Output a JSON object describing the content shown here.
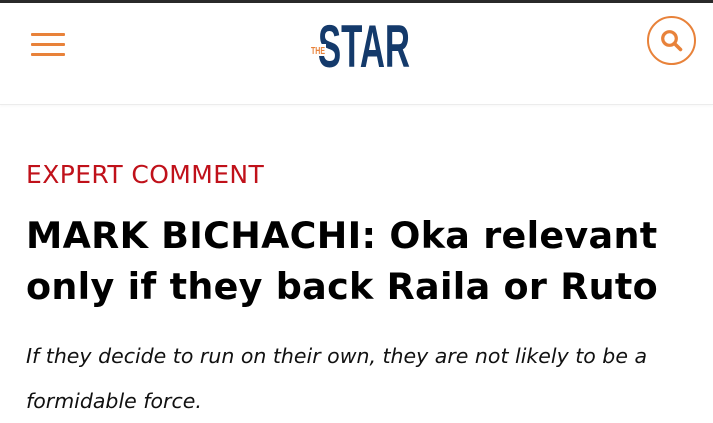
{
  "header": {
    "logo_small_text": "THE",
    "logo_text": "STAR",
    "logo_color": "#143a6b",
    "accent_color": "#e8823a",
    "menu_icon": "hamburger-menu-icon",
    "search_icon": "search-icon"
  },
  "article": {
    "category": "EXPERT COMMENT",
    "category_color": "#c0111a",
    "headline": "MARK BICHACHI: Oka relevant only if they back Raila or Ruto",
    "standfirst": "If they decide to run on their own, they are not likely to be a formidable force."
  }
}
